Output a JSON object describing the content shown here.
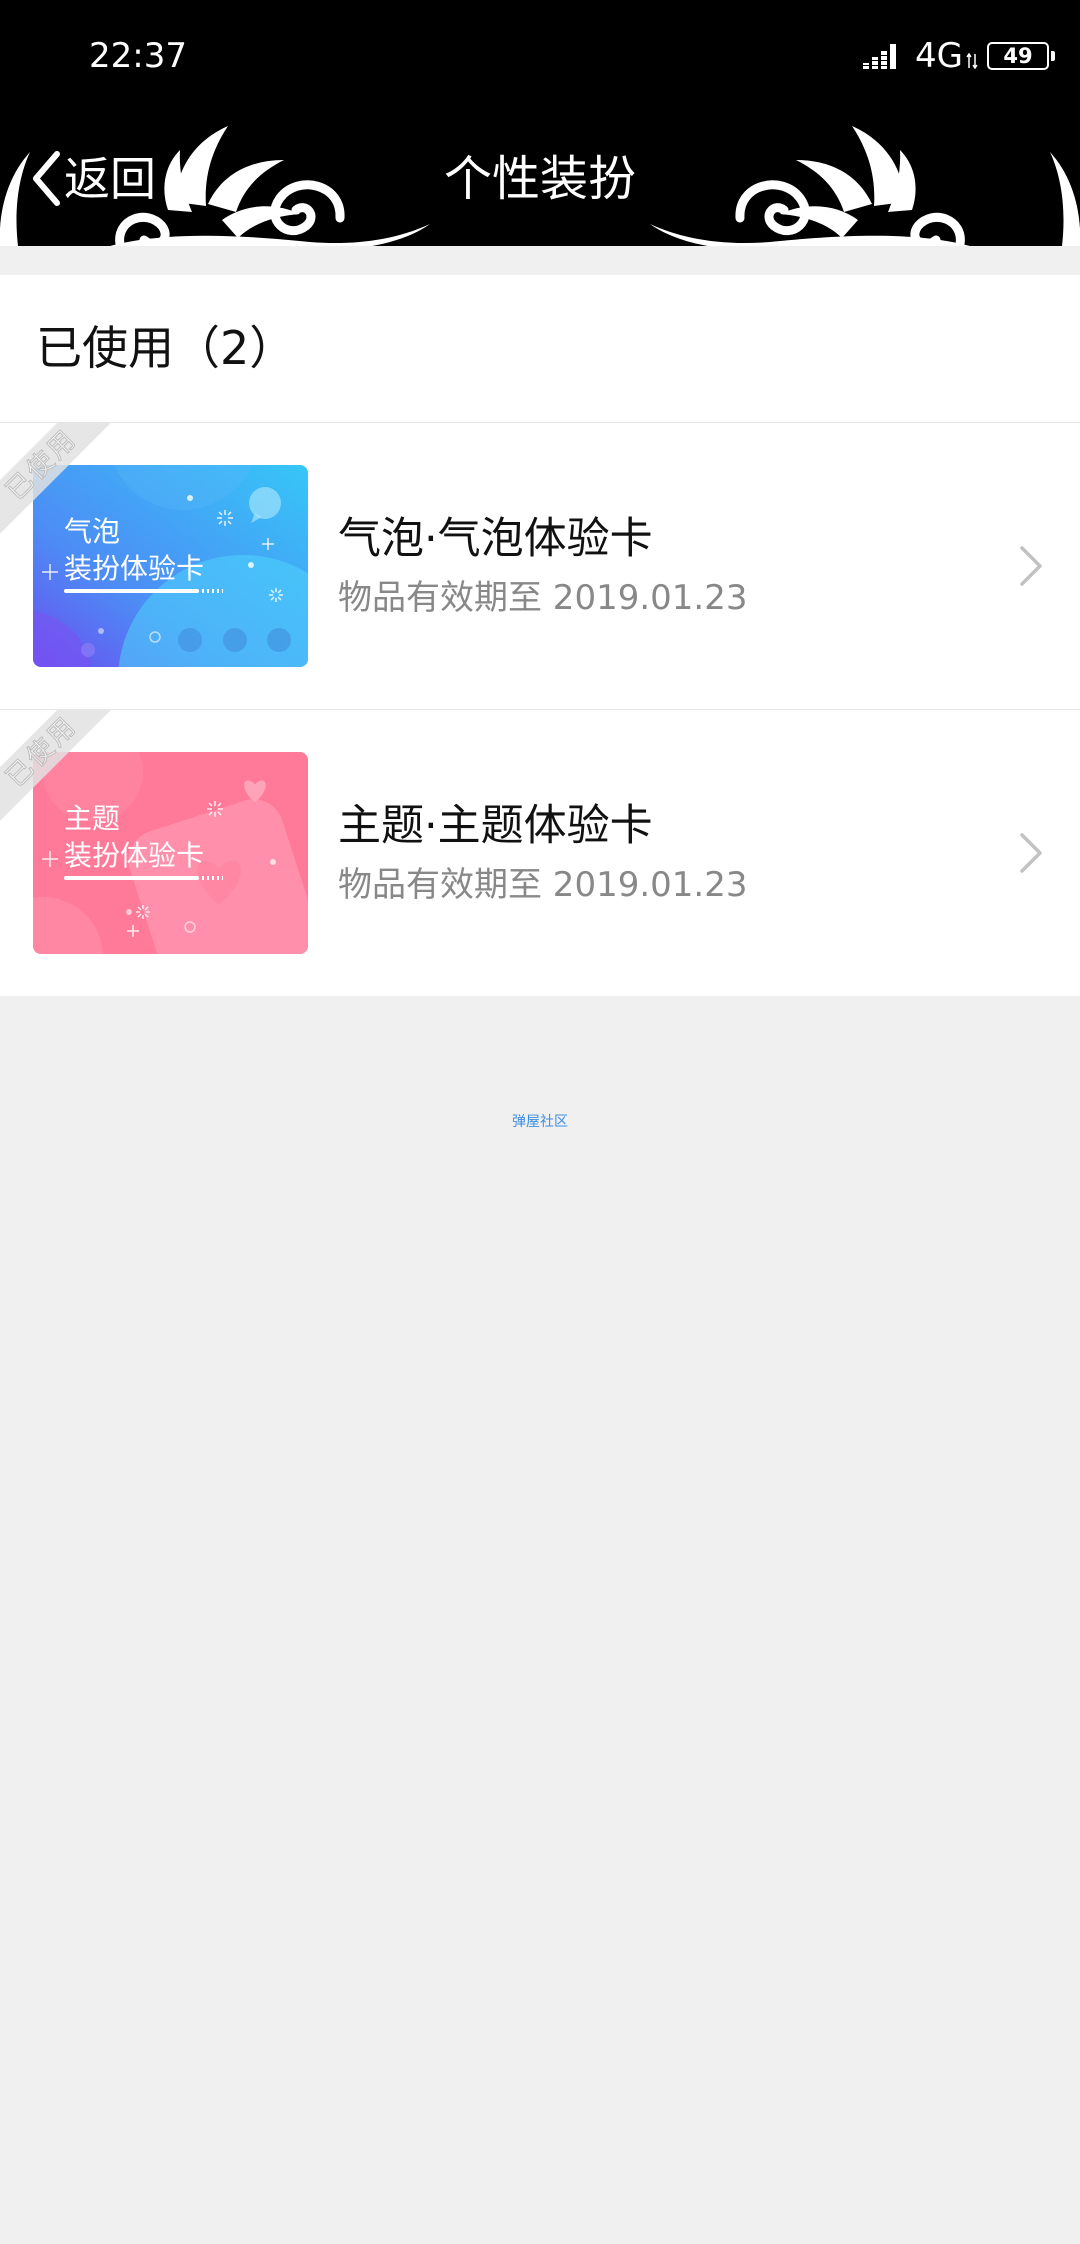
{
  "status_bar": {
    "time": "22:37",
    "network": "4G",
    "battery": "49"
  },
  "header": {
    "back_label": "返回",
    "title": "个性装扮"
  },
  "section": {
    "title": "已使用（2）"
  },
  "items": [
    {
      "badge": "已使用",
      "card_line1": "气泡",
      "card_line2": "装扮体验卡",
      "title": "气泡·气泡体验卡",
      "subtitle": "物品有效期至 2019.01.23"
    },
    {
      "badge": "已使用",
      "card_line1": "主题",
      "card_line2": "装扮体验卡",
      "title": "主题·主题体验卡",
      "subtitle": "物品有效期至 2019.01.23"
    }
  ],
  "footer": {
    "text": "弹屋社区"
  },
  "icons": {
    "back": "back-chevron-icon",
    "signal": "signal-icon",
    "battery": "battery-icon",
    "item_arrow": "chevron-right-icon",
    "ornament": "floral-ornament-icon"
  },
  "colors": {
    "header_bg": "#000000",
    "page_bg": "#f0f0f0",
    "card_blue": "#36c6f7",
    "card_pink": "#ff7a99",
    "footer_link": "#3d8fe0"
  }
}
